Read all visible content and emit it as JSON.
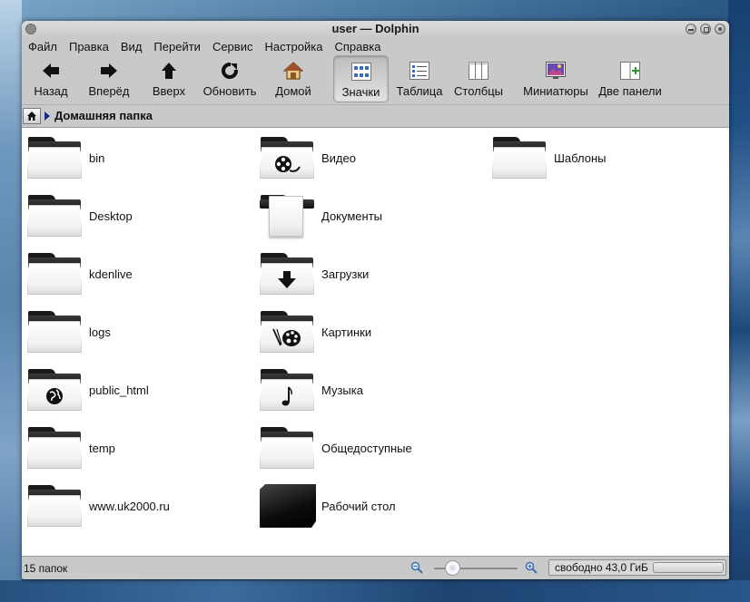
{
  "window": {
    "title": "user — Dolphin"
  },
  "menubar": [
    "Файл",
    "Правка",
    "Вид",
    "Перейти",
    "Сервис",
    "Настройка",
    "Справка"
  ],
  "toolbar": {
    "back": "Назад",
    "forward": "Вперёд",
    "up": "Вверх",
    "reload": "Обновить",
    "home": "Домой",
    "view_icons": "Значки",
    "view_details": "Таблица",
    "view_columns": "Столбцы",
    "preview": "Миниатюры",
    "split": "Две панели",
    "active_view": "Значки"
  },
  "location": {
    "current": "Домашняя папка"
  },
  "files": [
    {
      "name": "bin",
      "emblem": "none"
    },
    {
      "name": "Desktop",
      "emblem": "none"
    },
    {
      "name": "kdenlive",
      "emblem": "none"
    },
    {
      "name": "logs",
      "emblem": "none"
    },
    {
      "name": "public_html",
      "emblem": "globe-icon"
    },
    {
      "name": "temp",
      "emblem": "none"
    },
    {
      "name": "www.uk2000.ru",
      "emblem": "none"
    },
    {
      "name": "Видео",
      "emblem": "film-icon"
    },
    {
      "name": "Документы",
      "emblem": "document-icon"
    },
    {
      "name": "Загрузки",
      "emblem": "download-arrow-icon"
    },
    {
      "name": "Картинки",
      "emblem": "palette-icon"
    },
    {
      "name": "Музыка",
      "emblem": "music-note-icon"
    },
    {
      "name": "Общедоступные",
      "emblem": "none"
    },
    {
      "name": "Рабочий стол",
      "emblem": "desktop-slab-icon"
    },
    {
      "name": "Шаблоны",
      "emblem": "none"
    }
  ],
  "statusbar": {
    "count": "15 папок",
    "free_space": "свободно 43,0 ГиБ",
    "zoom_level": 0.22,
    "disk_used_fraction": 0.0
  }
}
